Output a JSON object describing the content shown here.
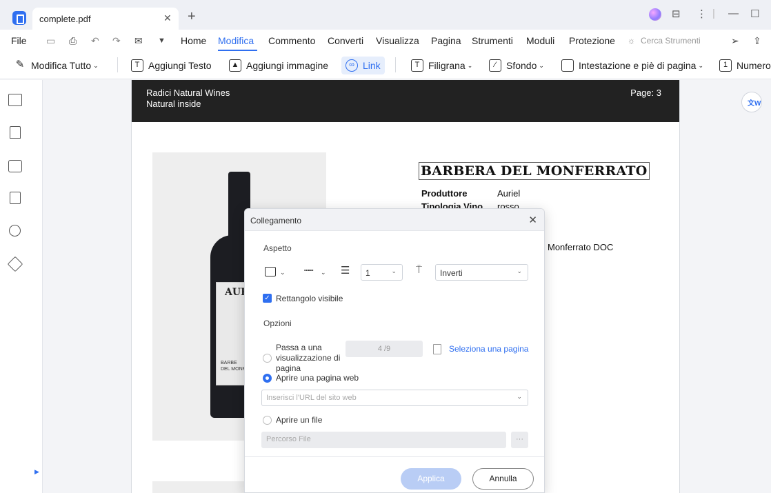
{
  "window": {
    "tab_title": "complete.pdf"
  },
  "menu": {
    "file": "File",
    "items": [
      "Home",
      "Modifica",
      "Commento",
      "Converti",
      "Visualizza",
      "Pagina",
      "Strumenti",
      "Moduli",
      "Protezione"
    ],
    "active": "Modifica",
    "search_tools": "Cerca Strumenti"
  },
  "toolbar": {
    "edit_all": "Modifica Tutto",
    "add_text": "Aggiungi Testo",
    "add_image": "Aggiungi immagine",
    "link": "Link",
    "watermark": "Filigrana",
    "background": "Sfondo",
    "header_footer": "Intestazione e piè di pagina",
    "number": "Numero"
  },
  "document": {
    "header_company": "Radici Natural Wines",
    "header_tagline": "Natural inside",
    "header_page": "Page: 3",
    "wine_title": "BARBERA DEL MONFERRATO",
    "bottle_brand": "AURI",
    "bottle_label": "BARBE",
    "bottle_label2": "DEL MONFE",
    "specs": [
      {
        "key": "Produttore",
        "value": "Auriel"
      },
      {
        "key": "Tipologia Vino",
        "value": "rosso"
      }
    ],
    "denomination": "Monferrato DOC"
  },
  "dialog": {
    "title": "Collegamento",
    "section_appearance": "Aspetto",
    "line_width": "1",
    "highlight": "Inverti",
    "visible_rect_label": "Rettangolo visibile",
    "visible_rect_checked": true,
    "section_options": "Opzioni",
    "option_page_view": "Passa a una visualizzazione di pagina",
    "page_number": "4 /9",
    "select_page": "Seleziona una pagina",
    "option_web": "Aprire una pagina web",
    "url_placeholder": "Inserisci l'URL del sito web",
    "option_file": "Aprire un file",
    "file_placeholder": "Percorso File",
    "browse": "···",
    "apply": "Applica",
    "cancel": "Annulla"
  }
}
